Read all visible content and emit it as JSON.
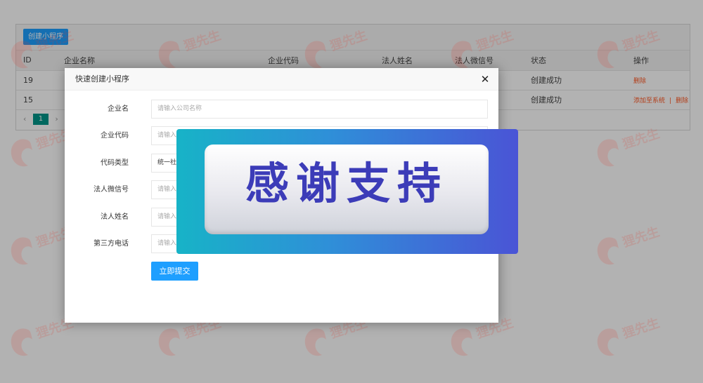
{
  "toolbar": {
    "create_label": "创建小程序"
  },
  "table": {
    "headers": {
      "id": "ID",
      "name": "企业名称",
      "code": "企业代码",
      "legal": "法人姓名",
      "wechat": "法人微信号",
      "status": "状态",
      "ops": "操作"
    },
    "rows": [
      {
        "id": "19",
        "status": "创建成功",
        "ops": [
          "删除"
        ]
      },
      {
        "id": "15",
        "status": "创建成功",
        "ops": [
          "添加至系统",
          "删除"
        ]
      }
    ],
    "op_separator": "|"
  },
  "pager": {
    "prev": "‹",
    "current": "1",
    "next": "›"
  },
  "modal": {
    "title": "快速创建小程序",
    "close": "✕",
    "fields": [
      {
        "label": "企业名",
        "placeholder": "请输入公司名称"
      },
      {
        "label": "企业代码",
        "placeholder": "请输入"
      },
      {
        "label": "代码类型",
        "value": "统一社会"
      },
      {
        "label": "法人微信号",
        "placeholder": "请输入"
      },
      {
        "label": "法人姓名",
        "placeholder": "请输入"
      },
      {
        "label": "第三方电话",
        "placeholder": "请输入"
      }
    ],
    "submit_label": "立即提交"
  },
  "banner": {
    "text": "感谢支持"
  },
  "watermark": {
    "text": "狸先生",
    "icon": "fox-logo-icon"
  },
  "colors": {
    "primary": "#1e9fff",
    "danger": "#ff5722",
    "pager_active": "#009688"
  }
}
